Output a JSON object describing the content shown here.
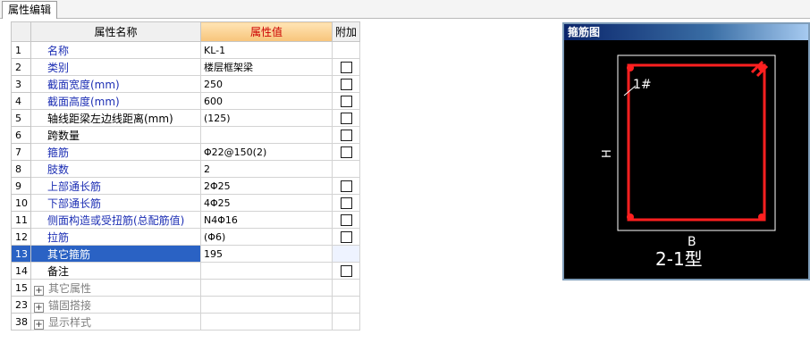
{
  "tab": {
    "label": "属性编辑"
  },
  "grid": {
    "headers": {
      "name": "属性名称",
      "value": "属性值",
      "extra": "附加"
    },
    "rows": [
      {
        "num": "1",
        "name": "名称",
        "value": "KL-1"
      },
      {
        "num": "2",
        "name": "类别",
        "value": "楼层框架梁"
      },
      {
        "num": "3",
        "name": "截面宽度(mm)",
        "value": "250"
      },
      {
        "num": "4",
        "name": "截面高度(mm)",
        "value": "600"
      },
      {
        "num": "5",
        "name": "轴线距梁左边线距离(mm)",
        "value": "(125)"
      },
      {
        "num": "6",
        "name": "跨数量",
        "value": ""
      },
      {
        "num": "7",
        "name": "箍筋",
        "value": "Φ22@150(2)"
      },
      {
        "num": "8",
        "name": "肢数",
        "value": "2"
      },
      {
        "num": "9",
        "name": "上部通长筋",
        "value": "2Φ25"
      },
      {
        "num": "10",
        "name": "下部通长筋",
        "value": "4Φ25"
      },
      {
        "num": "11",
        "name": "侧面构造或受扭筋(总配筋值)",
        "value": "N4Φ16"
      },
      {
        "num": "12",
        "name": "拉筋",
        "value": "(Φ6)"
      },
      {
        "num": "13",
        "name": "其它箍筋",
        "value": "195"
      },
      {
        "num": "14",
        "name": "备注",
        "value": ""
      },
      {
        "num": "15",
        "name": "其它属性",
        "value": ""
      },
      {
        "num": "23",
        "name": "锚固搭接",
        "value": ""
      },
      {
        "num": "38",
        "name": "显示样式",
        "value": ""
      }
    ]
  },
  "diagram": {
    "title": "箍筋图",
    "bar_label": "1#",
    "height_label": "H",
    "width_label": "B",
    "type_label": "2-1型",
    "colors": {
      "outline": "#ffffff",
      "stirrup": "#ff2020",
      "background": "#000000",
      "title_bar": "#0a246a"
    }
  }
}
